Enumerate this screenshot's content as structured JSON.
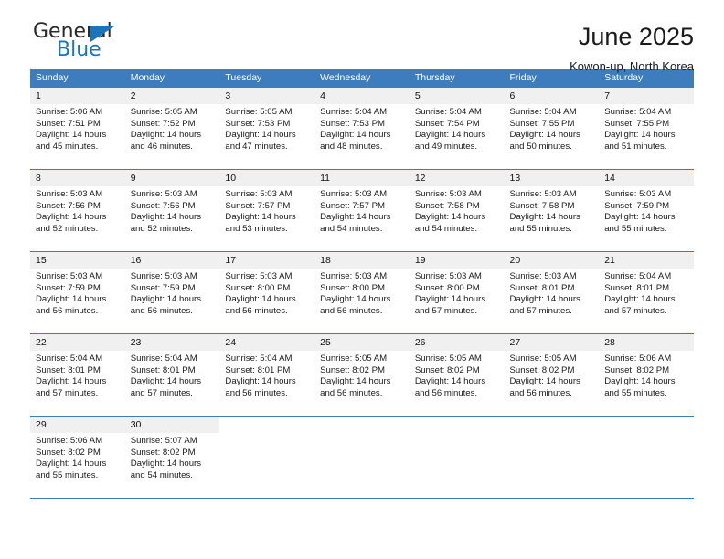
{
  "brand": {
    "name_part1": "General",
    "name_part2": "Blue",
    "accent_color": "#1b74bc"
  },
  "header": {
    "title": "June 2025",
    "subtitle": "Kowon-up, North Korea"
  },
  "calendar": {
    "header_bg": "#3d7cbd",
    "daynum_bg": "#f0f0f0",
    "weekdays": [
      "Sunday",
      "Monday",
      "Tuesday",
      "Wednesday",
      "Thursday",
      "Friday",
      "Saturday"
    ],
    "weeks": [
      [
        {
          "day": "1",
          "sunrise": "Sunrise: 5:06 AM",
          "sunset": "Sunset: 7:51 PM",
          "daylight1": "Daylight: 14 hours",
          "daylight2": "and 45 minutes."
        },
        {
          "day": "2",
          "sunrise": "Sunrise: 5:05 AM",
          "sunset": "Sunset: 7:52 PM",
          "daylight1": "Daylight: 14 hours",
          "daylight2": "and 46 minutes."
        },
        {
          "day": "3",
          "sunrise": "Sunrise: 5:05 AM",
          "sunset": "Sunset: 7:53 PM",
          "daylight1": "Daylight: 14 hours",
          "daylight2": "and 47 minutes."
        },
        {
          "day": "4",
          "sunrise": "Sunrise: 5:04 AM",
          "sunset": "Sunset: 7:53 PM",
          "daylight1": "Daylight: 14 hours",
          "daylight2": "and 48 minutes."
        },
        {
          "day": "5",
          "sunrise": "Sunrise: 5:04 AM",
          "sunset": "Sunset: 7:54 PM",
          "daylight1": "Daylight: 14 hours",
          "daylight2": "and 49 minutes."
        },
        {
          "day": "6",
          "sunrise": "Sunrise: 5:04 AM",
          "sunset": "Sunset: 7:55 PM",
          "daylight1": "Daylight: 14 hours",
          "daylight2": "and 50 minutes."
        },
        {
          "day": "7",
          "sunrise": "Sunrise: 5:04 AM",
          "sunset": "Sunset: 7:55 PM",
          "daylight1": "Daylight: 14 hours",
          "daylight2": "and 51 minutes."
        }
      ],
      [
        {
          "day": "8",
          "sunrise": "Sunrise: 5:03 AM",
          "sunset": "Sunset: 7:56 PM",
          "daylight1": "Daylight: 14 hours",
          "daylight2": "and 52 minutes."
        },
        {
          "day": "9",
          "sunrise": "Sunrise: 5:03 AM",
          "sunset": "Sunset: 7:56 PM",
          "daylight1": "Daylight: 14 hours",
          "daylight2": "and 52 minutes."
        },
        {
          "day": "10",
          "sunrise": "Sunrise: 5:03 AM",
          "sunset": "Sunset: 7:57 PM",
          "daylight1": "Daylight: 14 hours",
          "daylight2": "and 53 minutes."
        },
        {
          "day": "11",
          "sunrise": "Sunrise: 5:03 AM",
          "sunset": "Sunset: 7:57 PM",
          "daylight1": "Daylight: 14 hours",
          "daylight2": "and 54 minutes."
        },
        {
          "day": "12",
          "sunrise": "Sunrise: 5:03 AM",
          "sunset": "Sunset: 7:58 PM",
          "daylight1": "Daylight: 14 hours",
          "daylight2": "and 54 minutes."
        },
        {
          "day": "13",
          "sunrise": "Sunrise: 5:03 AM",
          "sunset": "Sunset: 7:58 PM",
          "daylight1": "Daylight: 14 hours",
          "daylight2": "and 55 minutes."
        },
        {
          "day": "14",
          "sunrise": "Sunrise: 5:03 AM",
          "sunset": "Sunset: 7:59 PM",
          "daylight1": "Daylight: 14 hours",
          "daylight2": "and 55 minutes."
        }
      ],
      [
        {
          "day": "15",
          "sunrise": "Sunrise: 5:03 AM",
          "sunset": "Sunset: 7:59 PM",
          "daylight1": "Daylight: 14 hours",
          "daylight2": "and 56 minutes."
        },
        {
          "day": "16",
          "sunrise": "Sunrise: 5:03 AM",
          "sunset": "Sunset: 7:59 PM",
          "daylight1": "Daylight: 14 hours",
          "daylight2": "and 56 minutes."
        },
        {
          "day": "17",
          "sunrise": "Sunrise: 5:03 AM",
          "sunset": "Sunset: 8:00 PM",
          "daylight1": "Daylight: 14 hours",
          "daylight2": "and 56 minutes."
        },
        {
          "day": "18",
          "sunrise": "Sunrise: 5:03 AM",
          "sunset": "Sunset: 8:00 PM",
          "daylight1": "Daylight: 14 hours",
          "daylight2": "and 56 minutes."
        },
        {
          "day": "19",
          "sunrise": "Sunrise: 5:03 AM",
          "sunset": "Sunset: 8:00 PM",
          "daylight1": "Daylight: 14 hours",
          "daylight2": "and 57 minutes."
        },
        {
          "day": "20",
          "sunrise": "Sunrise: 5:03 AM",
          "sunset": "Sunset: 8:01 PM",
          "daylight1": "Daylight: 14 hours",
          "daylight2": "and 57 minutes."
        },
        {
          "day": "21",
          "sunrise": "Sunrise: 5:04 AM",
          "sunset": "Sunset: 8:01 PM",
          "daylight1": "Daylight: 14 hours",
          "daylight2": "and 57 minutes."
        }
      ],
      [
        {
          "day": "22",
          "sunrise": "Sunrise: 5:04 AM",
          "sunset": "Sunset: 8:01 PM",
          "daylight1": "Daylight: 14 hours",
          "daylight2": "and 57 minutes."
        },
        {
          "day": "23",
          "sunrise": "Sunrise: 5:04 AM",
          "sunset": "Sunset: 8:01 PM",
          "daylight1": "Daylight: 14 hours",
          "daylight2": "and 57 minutes."
        },
        {
          "day": "24",
          "sunrise": "Sunrise: 5:04 AM",
          "sunset": "Sunset: 8:01 PM",
          "daylight1": "Daylight: 14 hours",
          "daylight2": "and 56 minutes."
        },
        {
          "day": "25",
          "sunrise": "Sunrise: 5:05 AM",
          "sunset": "Sunset: 8:02 PM",
          "daylight1": "Daylight: 14 hours",
          "daylight2": "and 56 minutes."
        },
        {
          "day": "26",
          "sunrise": "Sunrise: 5:05 AM",
          "sunset": "Sunset: 8:02 PM",
          "daylight1": "Daylight: 14 hours",
          "daylight2": "and 56 minutes."
        },
        {
          "day": "27",
          "sunrise": "Sunrise: 5:05 AM",
          "sunset": "Sunset: 8:02 PM",
          "daylight1": "Daylight: 14 hours",
          "daylight2": "and 56 minutes."
        },
        {
          "day": "28",
          "sunrise": "Sunrise: 5:06 AM",
          "sunset": "Sunset: 8:02 PM",
          "daylight1": "Daylight: 14 hours",
          "daylight2": "and 55 minutes."
        }
      ],
      [
        {
          "day": "29",
          "sunrise": "Sunrise: 5:06 AM",
          "sunset": "Sunset: 8:02 PM",
          "daylight1": "Daylight: 14 hours",
          "daylight2": "and 55 minutes."
        },
        {
          "day": "30",
          "sunrise": "Sunrise: 5:07 AM",
          "sunset": "Sunset: 8:02 PM",
          "daylight1": "Daylight: 14 hours",
          "daylight2": "and 54 minutes."
        },
        null,
        null,
        null,
        null,
        null
      ]
    ]
  }
}
